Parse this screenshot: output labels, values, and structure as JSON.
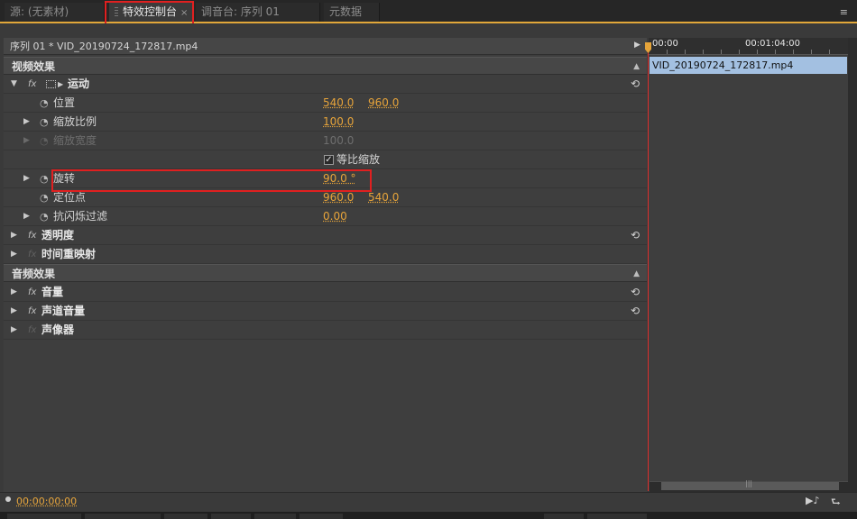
{
  "tabs": [
    {
      "label": "源: (无素材)"
    },
    {
      "label": "特效控制台",
      "close": "×"
    },
    {
      "label": "调音台: 序列 01"
    },
    {
      "label": "元数据"
    }
  ],
  "panel_menu_icon": "≡",
  "sequence_header": "序列 01 * VID_20190724_172817.mp4",
  "sections": {
    "video": "视频效果",
    "audio": "音频效果"
  },
  "effects": {
    "motion": "运动",
    "opacity": "透明度",
    "time_remap": "时间重映射",
    "volume": "音量",
    "channel_volume": "声道音量",
    "panner": "声像器"
  },
  "props": {
    "position": {
      "label": "位置",
      "x": "540.0",
      "y": "960.0"
    },
    "scale": {
      "label": "缩放比例",
      "value": "100.0"
    },
    "scale_width": {
      "label": "缩放宽度",
      "value": "100.0"
    },
    "uniform": {
      "label": "等比缩放",
      "checked": "✓"
    },
    "rotation": {
      "label": "旋转",
      "value": "90.0 °"
    },
    "anchor": {
      "label": "定位点",
      "x": "960.0",
      "y": "540.0"
    },
    "flicker": {
      "label": "抗闪烁过滤",
      "value": "0.00"
    }
  },
  "timeline": {
    "t0": "00:00",
    "t1": "00:01:04:00",
    "clip": "VID_20190724_172817.mp4"
  },
  "timecode": "00:00:00:00",
  "icons": {
    "reset": "⟲",
    "clock": "◔",
    "fx": "fx",
    "expand": "▶",
    "expanded": "▼",
    "collapse": "▲",
    "play": "▶♪",
    "export": "⮑"
  },
  "colors": {
    "accent": "#e7a43a",
    "clip": "#a3c0e1",
    "playhead": "#e0302e",
    "highlight": "#e02020"
  }
}
